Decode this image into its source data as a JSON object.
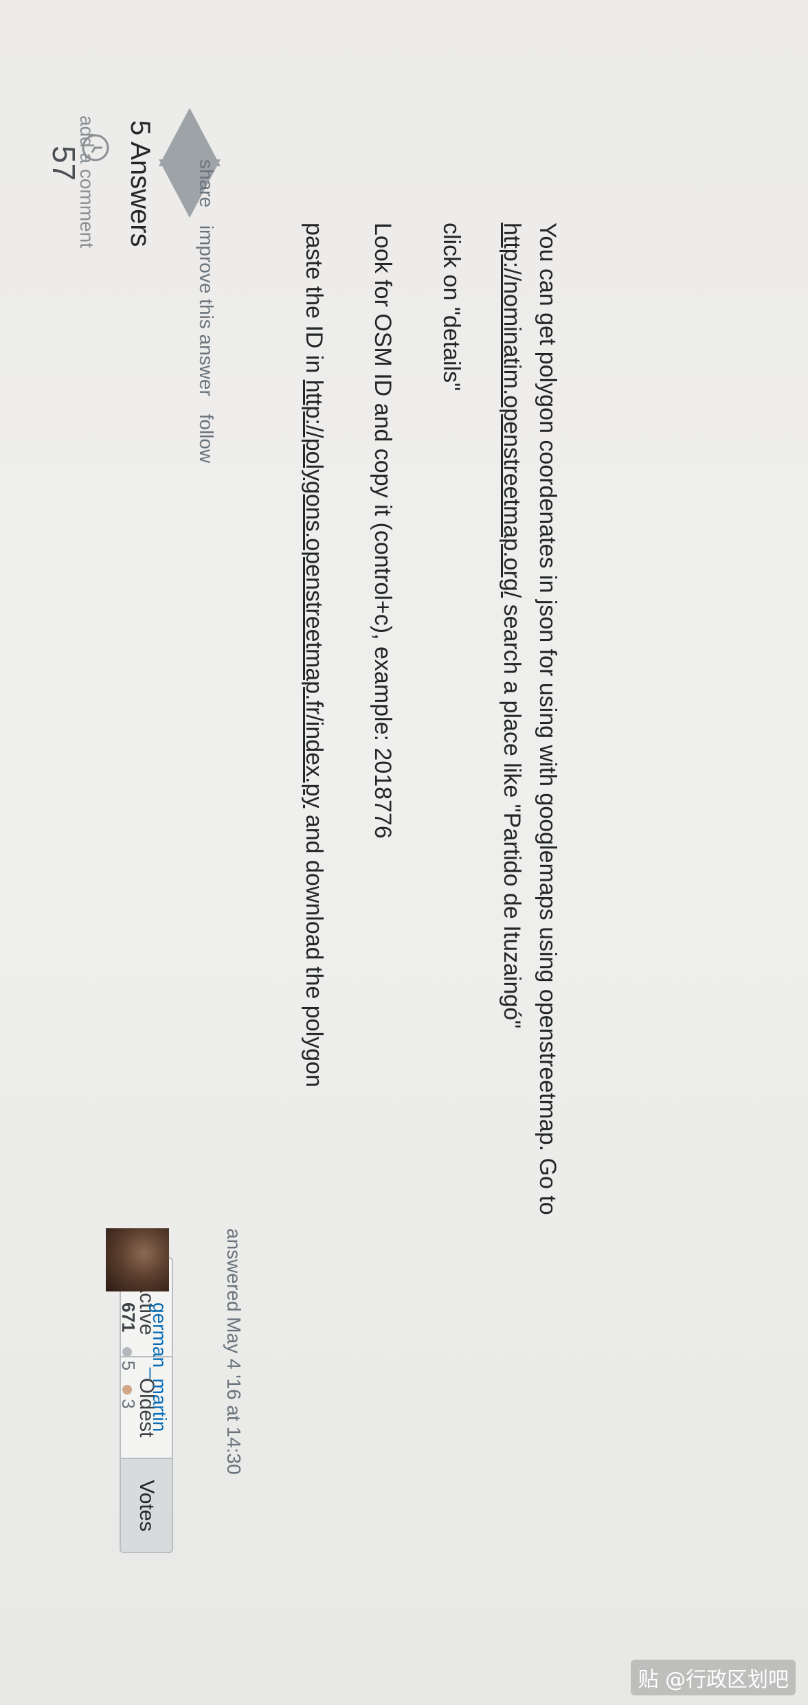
{
  "comment_link": "add a comment",
  "answers_header": "5 Answers",
  "sort_tabs": [
    {
      "label": "Active",
      "selected": false
    },
    {
      "label": "Oldest",
      "selected": false
    },
    {
      "label": "Votes",
      "selected": true
    }
  ],
  "answer": {
    "votes": "57",
    "paragraph1_a": "You can get polygon coordenates in json for using with googlemaps using openstreetmap. Go to",
    "paragraph1_link": "http://nominatim.openstreetmap.org/",
    "paragraph1_b": " search a place like \"Partido de Ituzaingó\"",
    "paragraph2": "click on \"details\"",
    "paragraph3": "Look for OSM ID and copy it (control+c), example: 2018776",
    "paragraph4_a": "paste the ID in ",
    "paragraph4_link": "http://polygons.openstreetmap.fr/index.py",
    "paragraph4_b": " and download the polygon",
    "post_menu": [
      "share",
      "improve this answer",
      "follow"
    ],
    "answered_label": "answered May 4 '16 at 14:30",
    "author": "german_martin",
    "reputation": "671",
    "silver_badges": "5",
    "bronze_badges": "3"
  },
  "watermark": "贴 @行政区划吧",
  "colors": {
    "link": "#0a6cb6",
    "text": "#232629",
    "muted": "#6a737c",
    "selected_tab": "#d8dadc"
  }
}
